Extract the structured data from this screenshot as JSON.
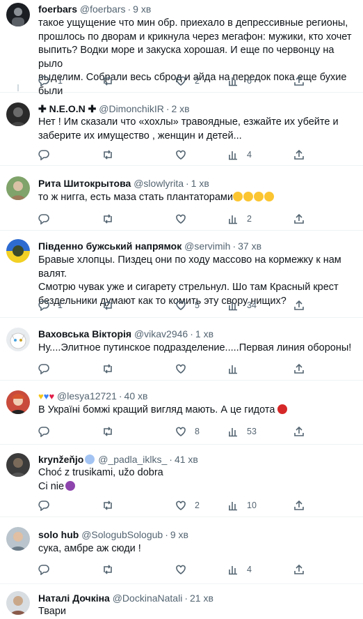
{
  "tweets": [
    {
      "name": "foerbars",
      "handle": "@foerbars",
      "time": "9 хв",
      "lines": [
        "такое ущущение что мин обр. приехало в депрессивные регионы,",
        "прошлось по дворам и крикнула через мегафон: мужики, кто хочет",
        "выпить? Водки море и закуска хорошая. И еще по червонцу на рыло",
        "выделим. Собрали весь сброд и айда на передок пока еще бухие были"
      ],
      "replies": "1",
      "retweets": "",
      "likes": "2",
      "views": "6"
    },
    {
      "name": "✚ N.E.O.N ✚",
      "handle": "@DimonchikIR",
      "time": "2 хв",
      "lines": [
        "Нет ! Им сказали что «хохлы» травоядные, езжайте их убейте и",
        "заберите их имущество , женщин и детей..."
      ],
      "replies": "",
      "retweets": "",
      "likes": "",
      "views": "4"
    },
    {
      "name": "Рита Шитокрытова",
      "handle": "@slowlyrita",
      "time": "1 хв",
      "lines": [
        "то ж нигга, есть маза стать плантаторами"
      ],
      "emoji_line": [
        "laughing-cry",
        "laughing-cry",
        "laughing-cry",
        "laughing-cry"
      ],
      "replies": "",
      "retweets": "",
      "likes": "",
      "views": "2"
    },
    {
      "name": "Південно бужський напрямок",
      "handle": "@servimih",
      "time": "37 хв",
      "lines": [
        "Бравые хлопцы. Пиздец они по ходу массово на кормежку к нам валят.",
        "Смотрю чувак уже и сигарету стрельнул. Шо там Красный крест",
        "бездельники думают как то комить эту свору нищих?"
      ],
      "replies": "1",
      "retweets": "",
      "likes": "5",
      "views": "34"
    },
    {
      "name": "Ваховська Вікторія",
      "handle": "@vikav2946",
      "time": "1 хв",
      "lines": [
        "Ну....Элитное путинское подразделение.....Первая линия обороны!"
      ],
      "replies": "",
      "retweets": "",
      "likes": "",
      "views": ""
    },
    {
      "name": "",
      "handle": "@lesya12721",
      "time": "40 хв",
      "lines": [
        "В Україні бомжі кращий вигляд мають. А це гидота"
      ],
      "replies": "",
      "retweets": "",
      "likes": "8",
      "views": "53"
    },
    {
      "name": "krynžeňjo",
      "handle": "@_padla_iklks_",
      "time": "41 хв",
      "lines": [
        "Choć z trusikami, užo dobra",
        "Ci nie"
      ],
      "replies": "",
      "retweets": "",
      "likes": "2",
      "views": "10"
    },
    {
      "name": "solo hub",
      "handle": "@SologubSologub",
      "time": "9 хв",
      "lines": [
        "сука, амбре аж сюди !"
      ],
      "replies": "",
      "retweets": "",
      "likes": "",
      "views": "4"
    },
    {
      "name": "Наталі Дочкіна",
      "handle": "@DockinaNatali",
      "time": "21 хв",
      "lines": [
        "Твари"
      ]
    }
  ],
  "colors": {
    "text": "#0f1419",
    "muted": "#536471",
    "verified": "#1d9bf0",
    "divider": "#eff3f4"
  }
}
